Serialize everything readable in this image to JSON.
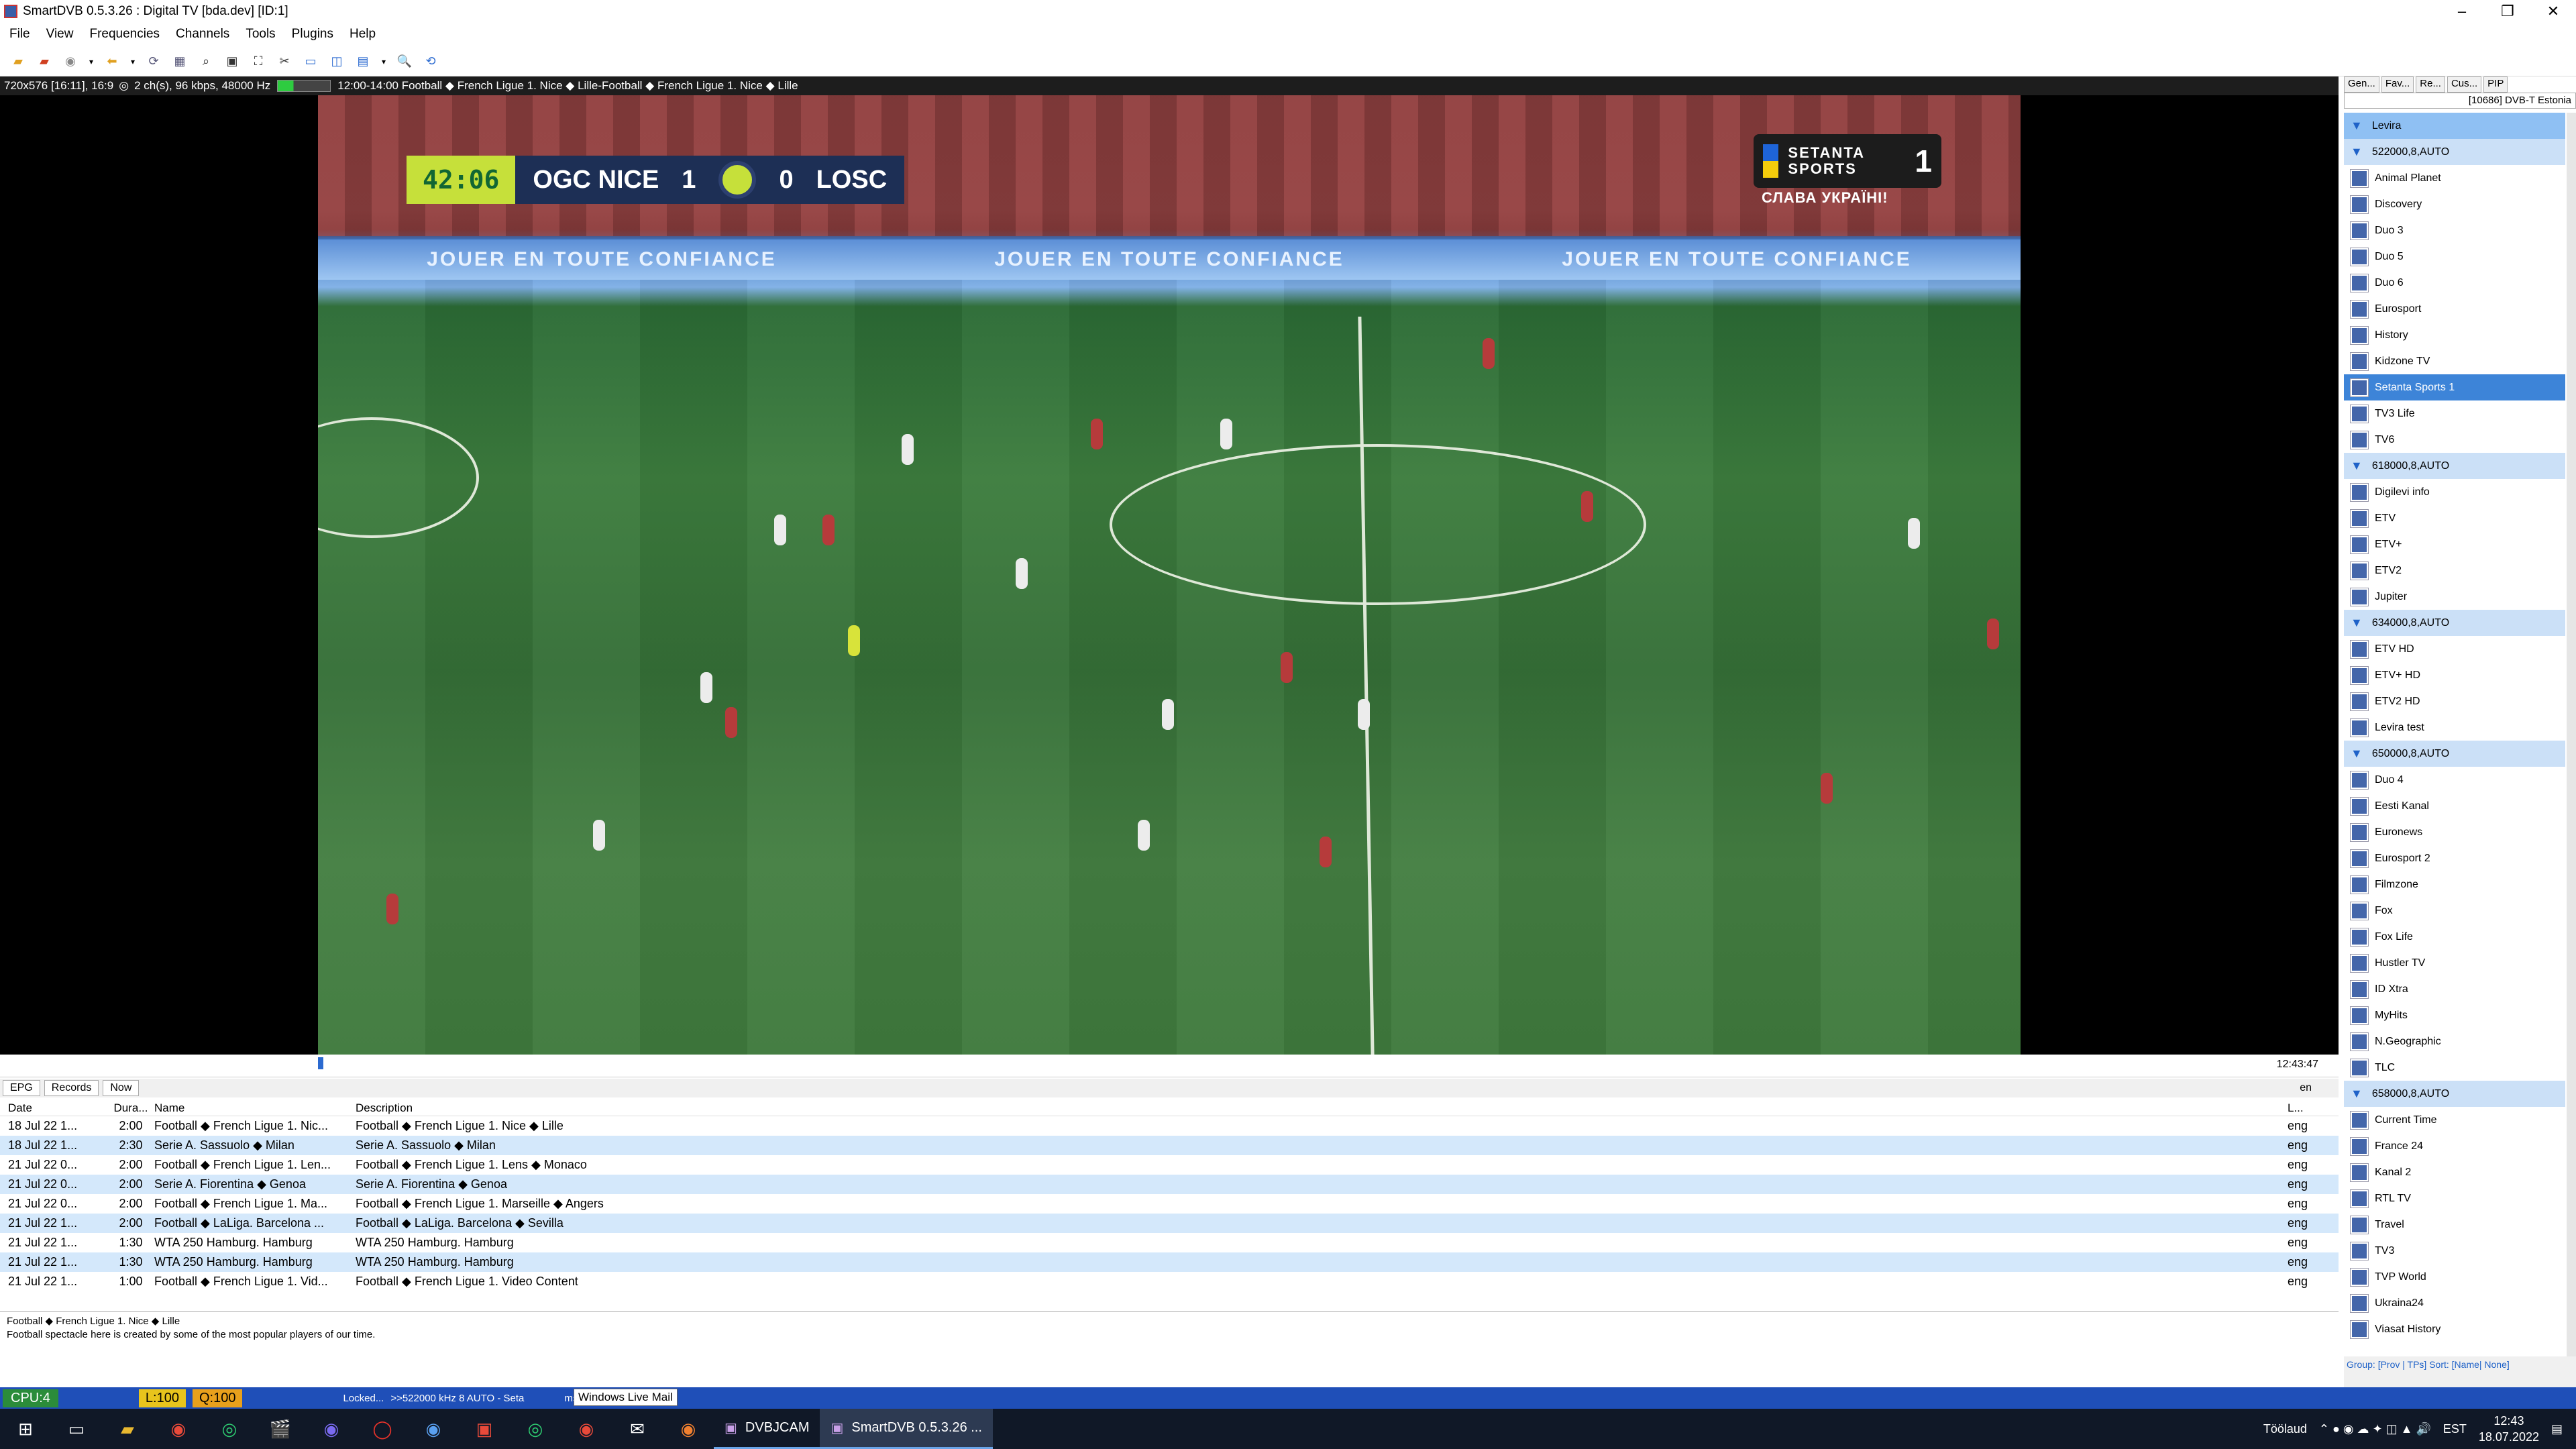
{
  "window": {
    "title": "SmartDVB 0.5.3.26 : Digital TV [bda.dev]  [ID:1]"
  },
  "menu": [
    "File",
    "View",
    "Frequencies",
    "Channels",
    "Tools",
    "Plugins",
    "Help"
  ],
  "infobar": {
    "video": "720x576 [16:11], 16:9",
    "audio": "2 ch(s), 96 kbps, 48000 Hz",
    "program": "12:00-14:00 Football ◆ French Ligue 1. Nice ◆ Lille-Football ◆ French Ligue 1. Nice ◆ Lille"
  },
  "broadcast": {
    "clock": "42:06",
    "home": "OGC NICE",
    "home_score": "1",
    "away_score": "0",
    "away": "LOSC",
    "ad": "JOUER EN TOUTE CONFIANCE",
    "channel_logo": "SETANTA SPORTS",
    "channel_num": "1",
    "channel_sub": "СЛАВА УКРАЇНІ!"
  },
  "seek": {
    "time": "12:43:47"
  },
  "epg": {
    "tabs": [
      "EPG",
      "Records",
      "Now"
    ],
    "lang_select": "en",
    "columns": [
      "Date",
      "Dura...",
      "Name",
      "Description",
      "L..."
    ],
    "rows": [
      {
        "date": "18 Jul 22 1...",
        "dur": "2:00",
        "name": "Football ◆ French Ligue 1. Nic...",
        "desc": "Football ◆ French Ligue 1. Nice ◆ Lille",
        "lang": "eng"
      },
      {
        "date": "18 Jul 22 1...",
        "dur": "2:30",
        "name": "Serie A. Sassuolo ◆ Milan",
        "desc": "Serie A. Sassuolo ◆ Milan",
        "lang": "eng"
      },
      {
        "date": "21 Jul 22 0...",
        "dur": "2:00",
        "name": "Football ◆ French Ligue 1. Len...",
        "desc": "Football ◆ French Ligue 1. Lens ◆ Monaco",
        "lang": "eng"
      },
      {
        "date": "21 Jul 22 0...",
        "dur": "2:00",
        "name": "Serie A. Fiorentina ◆ Genoa",
        "desc": "Serie A. Fiorentina ◆ Genoa",
        "lang": "eng"
      },
      {
        "date": "21 Jul 22 0...",
        "dur": "2:00",
        "name": "Football ◆ French Ligue 1. Ma...",
        "desc": "Football ◆ French Ligue 1. Marseille ◆ Angers",
        "lang": "eng"
      },
      {
        "date": "21 Jul 22 1...",
        "dur": "2:00",
        "name": "Football ◆ LaLiga. Barcelona ...",
        "desc": "Football ◆ LaLiga. Barcelona ◆ Sevilla",
        "lang": "eng"
      },
      {
        "date": "21 Jul 22 1...",
        "dur": "1:30",
        "name": "WTA 250 Hamburg. Hamburg",
        "desc": "WTA 250 Hamburg. Hamburg",
        "lang": "eng"
      },
      {
        "date": "21 Jul 22 1...",
        "dur": "1:30",
        "name": "WTA 250 Hamburg. Hamburg",
        "desc": "WTA 250 Hamburg. Hamburg",
        "lang": "eng"
      },
      {
        "date": "21 Jul 22 1...",
        "dur": "1:00",
        "name": "Football ◆ French Ligue 1. Vid...",
        "desc": "Football ◆ French Ligue 1. Video Content",
        "lang": "eng"
      }
    ],
    "description_title": "Football ◆ French Ligue 1. Nice ◆ Lille",
    "description_text": "Football spectacle here is created by some of the most popular players of our time."
  },
  "status": {
    "cpu": "CPU:4",
    "level": "L:100",
    "quality": "Q:100",
    "locked": "Locked...",
    "freq": ">>522000 kHz 8 AUTO - Seta",
    "tail": "ms) <<",
    "tooltip": "Windows Live Mail"
  },
  "sidebar": {
    "tabs": [
      "Gen...",
      "Fav...",
      "Re...",
      "Cus...",
      "PIP"
    ],
    "network": "[10686] DVB-T Estonia",
    "items": [
      {
        "kind": "grouptop",
        "label": "Levira"
      },
      {
        "kind": "group",
        "label": "522000,8,AUTO"
      },
      {
        "kind": "ch",
        "label": "Animal Planet"
      },
      {
        "kind": "ch",
        "label": "Discovery"
      },
      {
        "kind": "ch",
        "label": "Duo 3"
      },
      {
        "kind": "ch",
        "label": "Duo 5"
      },
      {
        "kind": "ch",
        "label": "Duo 6"
      },
      {
        "kind": "ch",
        "label": "Eurosport"
      },
      {
        "kind": "ch",
        "label": "History"
      },
      {
        "kind": "ch",
        "label": "Kidzone TV"
      },
      {
        "kind": "sel",
        "label": "Setanta Sports 1"
      },
      {
        "kind": "ch",
        "label": "TV3 Life"
      },
      {
        "kind": "ch",
        "label": "TV6"
      },
      {
        "kind": "group",
        "label": "618000,8,AUTO"
      },
      {
        "kind": "ch",
        "label": "Digilevi info"
      },
      {
        "kind": "ch",
        "label": "ETV"
      },
      {
        "kind": "ch",
        "label": "ETV+"
      },
      {
        "kind": "ch",
        "label": "ETV2"
      },
      {
        "kind": "ch",
        "label": "Jupiter"
      },
      {
        "kind": "group",
        "label": "634000,8,AUTO"
      },
      {
        "kind": "ch",
        "label": "ETV HD"
      },
      {
        "kind": "ch",
        "label": "ETV+ HD"
      },
      {
        "kind": "ch",
        "label": "ETV2 HD"
      },
      {
        "kind": "ch",
        "label": "Levira test"
      },
      {
        "kind": "group",
        "label": "650000,8,AUTO"
      },
      {
        "kind": "ch",
        "label": "Duo 4"
      },
      {
        "kind": "ch",
        "label": "Eesti Kanal"
      },
      {
        "kind": "ch",
        "label": "Euronews"
      },
      {
        "kind": "ch",
        "label": "Eurosport 2"
      },
      {
        "kind": "ch",
        "label": "Filmzone"
      },
      {
        "kind": "ch",
        "label": "Fox"
      },
      {
        "kind": "ch",
        "label": "Fox Life"
      },
      {
        "kind": "ch",
        "label": "Hustler TV"
      },
      {
        "kind": "ch",
        "label": "ID Xtra"
      },
      {
        "kind": "ch",
        "label": "MyHits"
      },
      {
        "kind": "ch",
        "label": "N.Geographic"
      },
      {
        "kind": "ch",
        "label": "TLC"
      },
      {
        "kind": "group",
        "label": "658000,8,AUTO"
      },
      {
        "kind": "ch",
        "label": "Current Time"
      },
      {
        "kind": "ch",
        "label": "France 24"
      },
      {
        "kind": "ch",
        "label": "Kanal 2"
      },
      {
        "kind": "ch",
        "label": "RTL TV"
      },
      {
        "kind": "ch",
        "label": "Travel"
      },
      {
        "kind": "ch",
        "label": "TV3"
      },
      {
        "kind": "ch",
        "label": "TVP World"
      },
      {
        "kind": "ch",
        "label": "Ukraina24"
      },
      {
        "kind": "ch",
        "label": "Viasat History"
      }
    ],
    "footer": "Group: [Prov | TPs] Sort: [Name| None]"
  },
  "taskbar": {
    "tasks": [
      {
        "label": "DVBJCAM",
        "active": false
      },
      {
        "label": "SmartDVB 0.5.3.26 ...",
        "active": true
      }
    ],
    "tray_label": "Töölaud",
    "lang": "EST",
    "time": "12:43",
    "date": "18.07.2022"
  }
}
